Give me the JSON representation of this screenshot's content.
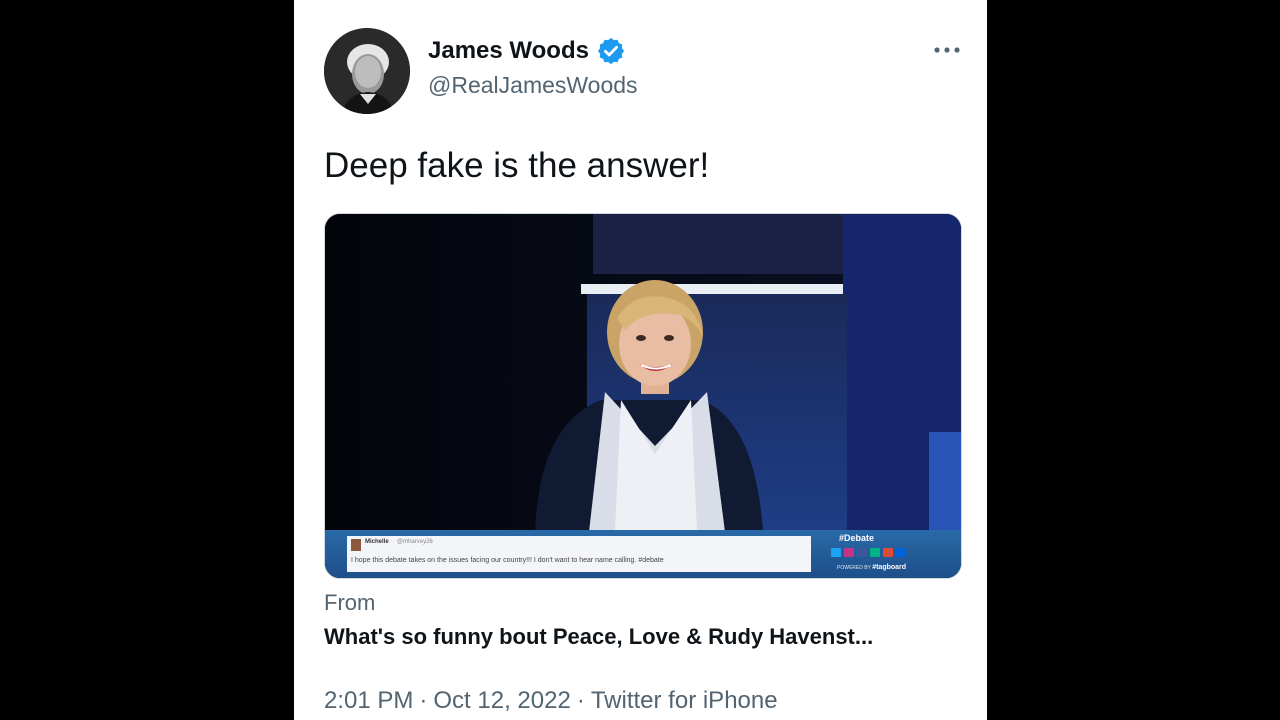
{
  "author": {
    "name": "James Woods",
    "handle": "@RealJamesWoods",
    "verified_color": "#1d9bf0"
  },
  "more_icon": "more-horizontal-icon",
  "tweet": {
    "text": "Deep fake is the answer!"
  },
  "media": {
    "ticker": {
      "user": "Michelle",
      "user_handle": "@mharvey26",
      "message": "I hope this debate takes on the issues facing our country!!! I don't want to hear name calling. #debate",
      "hashtag": "#Debate",
      "powered_by": "POWERED BY",
      "brand": "#tagboard"
    }
  },
  "source": {
    "label": "From",
    "title": "What's so funny bout Peace, Love & Rudy Havenst..."
  },
  "meta": {
    "time": "2:01 PM",
    "date": "Oct 12, 2022",
    "client": "Twitter for iPhone",
    "separator": "·"
  }
}
